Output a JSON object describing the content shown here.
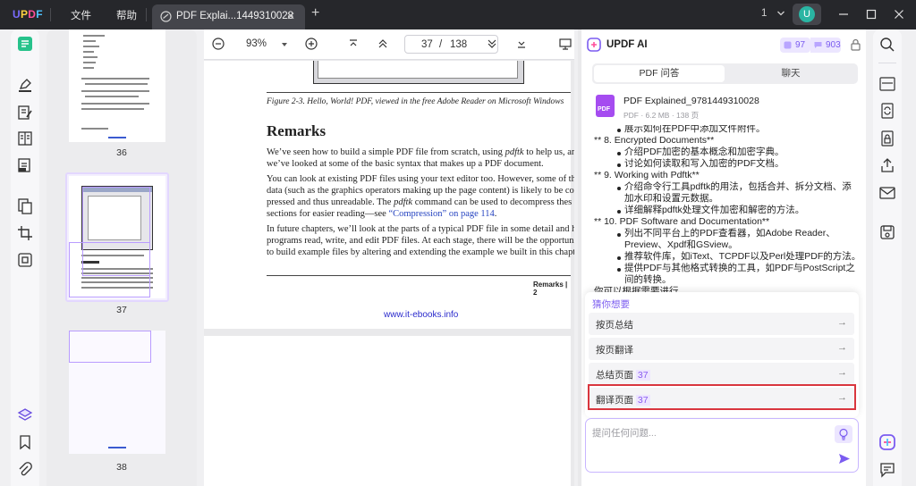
{
  "titlebar": {
    "logo": [
      "U",
      "P",
      "D",
      "F"
    ],
    "menu_file": "文件",
    "menu_help": "帮助",
    "tab_title": "PDF Explai...1449310028",
    "tab_close": "✕",
    "new_tab": "+",
    "window_count": "1",
    "avatar_letter": "U"
  },
  "thumbnails": {
    "pages": [
      {
        "number": "36"
      },
      {
        "number": "37"
      },
      {
        "number": "38"
      }
    ]
  },
  "doc_toolbar": {
    "zoom": "93%",
    "page_current": "37",
    "page_separator": "/",
    "page_total": "138"
  },
  "page": {
    "caption": "Figure 2-3. Hello, World! PDF, viewed in the free Adobe Reader on Microsoft Windows",
    "heading": "Remarks",
    "para1_l1_a": "We’ve seen how to build a simple PDF file from scratch, using ",
    "para1_l1_it": "pdftk",
    "para1_l1_b": " to help us, and",
    "para1_l2": "we’ve looked at some of the basic syntax that makes up a PDF document.",
    "para2_l1": "You can look at existing PDF files using your text editor too. However, some of th",
    "para2_l2": "data (such as the graphics operators making up the page content) is likely to be com",
    "para2_l3_a": "pressed and thus unreadable. The ",
    "para2_l3_it": "pdftk",
    "para2_l3_b": " command can be used to decompress thes",
    "para2_l4_a": "sections for easier reading—see ",
    "para2_l4_link": "“Compression” on page 114",
    "para2_l4_b": ".",
    "para3_l1": "In future chapters, we’ll look at the parts of a typical PDF file in some detail and hov",
    "para3_l2": "programs read, write, and edit PDF files. At each stage, there will be the opportunit",
    "para3_l3": "to build example files by altering and extending the example we built in this chapter.",
    "footer": "Remarks  |  2",
    "url": "www.it-ebooks.info"
  },
  "ai_panel": {
    "title": "UPDF AI",
    "badge_a": "97",
    "badge_b": "903",
    "tab_pdf_qa": "PDF 问答",
    "tab_chat": "聊天",
    "file_name": "PDF Explained_9781449310028",
    "file_meta": "PDF · 6.2 MB · 138 页",
    "file_icon_label": "PDF",
    "lines": [
      "展示如何在PDF中添加文件附件。",
      "** 8. Encrypted Documents**",
      "介绍PDF加密的基本概念和加密字典。",
      "讨论如何读取和写入加密的PDF文档。",
      "** 9. Working with Pdftk**",
      "介绍命令行工具pdftk的用法，包括合并、拆分文档、添",
      "加水印和设置元数据。",
      "详细解释pdftk处理文件加密和解密的方法。",
      "** 10. PDF Software and Documentation**",
      "列出不同平台上的PDF查看器，如Adobe Reader、",
      "Preview、Xpdf和GSview。",
      "推荐软件库，如iText、TCPDF以及Perl处理PDF的方法。",
      "提供PDF与其他格式转换的工具，如PDF与PostScript之",
      "间的转换。",
      "你可以根据需要进行"
    ],
    "suggest_title": "猜你想要",
    "suggestions": [
      {
        "label": "按页总结",
        "num": ""
      },
      {
        "label": "按页翻译",
        "num": ""
      },
      {
        "label": "总结页面",
        "num": "37"
      },
      {
        "label": "翻译页面",
        "num": "37"
      }
    ],
    "arrow": "→",
    "input_placeholder": "提问任何问题..."
  },
  "colors": {
    "accent": "#7b5cf0",
    "titlebar": "#26272b",
    "highlight_border": "#d9363e"
  }
}
